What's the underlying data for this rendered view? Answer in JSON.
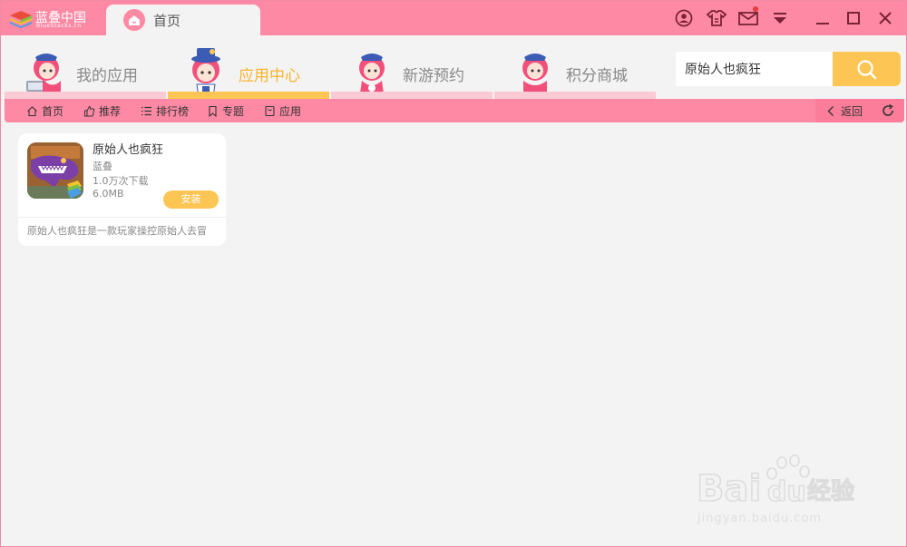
{
  "titlebar": {
    "logo_cn": "蓝叠中国",
    "logo_en": "BlueStacks.cn",
    "home_tab_label": "首页"
  },
  "nav": {
    "tabs": [
      {
        "label": "我的应用",
        "active": false
      },
      {
        "label": "应用中心",
        "active": true
      },
      {
        "label": "新游预约",
        "active": false
      },
      {
        "label": "积分商城",
        "active": false
      }
    ]
  },
  "search": {
    "value": "原始人也疯狂"
  },
  "subbar": {
    "items": [
      {
        "label": "首页",
        "icon": "home-icon"
      },
      {
        "label": "推荐",
        "icon": "thumbs-up-icon"
      },
      {
        "label": "排行榜",
        "icon": "list-icon"
      },
      {
        "label": "专题",
        "icon": "bookmark-icon"
      },
      {
        "label": "应用",
        "icon": "app-box-icon"
      }
    ],
    "back_label": "返回"
  },
  "result": {
    "name": "原始人也疯狂",
    "publisher": "蓝叠",
    "downloads": "1.0万次下载",
    "size": "6.0MB",
    "install_label": "安装",
    "description": "原始人也疯狂是一款玩家操控原始人去冒"
  },
  "watermark": {
    "text": "Bai du 经验",
    "sub": "jingyan.baidu.com"
  },
  "colors": {
    "brand_pink": "#fd89a4",
    "accent_yellow": "#fdc553",
    "background": "#f3f3f3"
  }
}
